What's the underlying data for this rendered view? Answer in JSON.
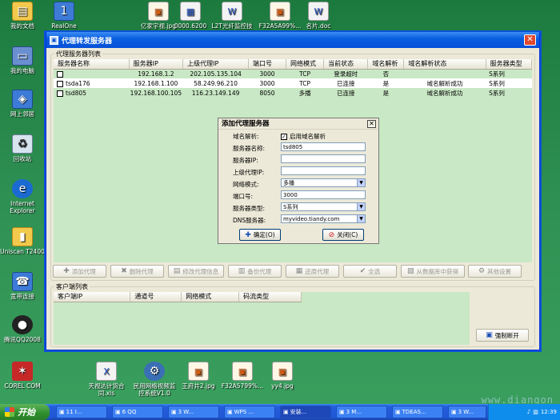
{
  "desktop": {
    "icons": [
      {
        "label": "我的文档",
        "glyph": "▤",
        "kind": "folder"
      },
      {
        "label": "我的电脑",
        "glyph": "▭",
        "kind": "pc"
      },
      {
        "label": "网上邻居",
        "glyph": "◈",
        "kind": "net"
      },
      {
        "label": "回收站",
        "glyph": "♻",
        "kind": "bin"
      },
      {
        "label": "Internet Explorer",
        "glyph": "e",
        "kind": "ie"
      },
      {
        "label": "Uniscan T2400",
        "glyph": "▮",
        "kind": "folder"
      },
      {
        "label": "宽带连接",
        "glyph": "☎",
        "kind": "net"
      },
      {
        "label": "腾讯QQ2008",
        "glyph": "●",
        "kind": "qq"
      },
      {
        "label": "COREL COM",
        "glyph": "✶",
        "kind": "red"
      },
      {
        "label": "RealOne Player",
        "glyph": "1",
        "kind": "net"
      },
      {
        "label": "亿家宇视.jpg",
        "glyph": "▣",
        "kind": "jpg"
      },
      {
        "label": "0000.6200",
        "glyph": "▦",
        "kind": "doc"
      },
      {
        "label": "L2T光纤监控技术方案...",
        "glyph": "W",
        "kind": "doc"
      },
      {
        "label": "F32A5A99%...",
        "glyph": "▣",
        "kind": "jpg"
      },
      {
        "label": "名片.doc",
        "glyph": "W",
        "kind": "doc"
      },
      {
        "label": "天视达计货合同.xls",
        "glyph": "X",
        "kind": "doc"
      },
      {
        "label": "民用网络视频监控系统V1.0",
        "glyph": "⚙",
        "kind": "gear"
      },
      {
        "label": "王府井2.jpg",
        "glyph": "▣",
        "kind": "jpg"
      },
      {
        "label": "F32A5799%...",
        "glyph": "▣",
        "kind": "jpg"
      },
      {
        "label": "yy4.jpg",
        "glyph": "▣",
        "kind": "jpg"
      }
    ]
  },
  "window": {
    "title": "代理转发服务器",
    "close_glyph": "✕",
    "server_list": {
      "legend": "代理服务器列表",
      "columns": [
        "服务器名称",
        "服务器IP",
        "上级代理IP",
        "端口号",
        "网络模式",
        "当前状态",
        "域名解析",
        "域名解析状态",
        "服务器类型"
      ],
      "rows": [
        {
          "name": "",
          "ip": "192.168.1.2",
          "proxy": "202.105.135.104",
          "port": "3000",
          "mode": "TCP",
          "status": "登录超时",
          "dns": "否",
          "dns_status": "",
          "type": "S系列"
        },
        {
          "name": "tsda176",
          "ip": "192.168.1.100",
          "proxy": "58.249.96.210",
          "port": "3000",
          "mode": "TCP",
          "status": "已连接",
          "dns": "是",
          "dns_status": "域名解析成功",
          "type": "S系列"
        },
        {
          "name": "tsd805",
          "ip": "192.168.100.105",
          "proxy": "116.23.149.149",
          "port": "8050",
          "mode": "多播",
          "status": "已连接",
          "dns": "是",
          "dns_status": "域名解析成功",
          "type": "S系列"
        }
      ]
    },
    "toolbar": {
      "add": "添加代理",
      "delete": "删除代理",
      "modify": "修改代理信息",
      "backup": "备份代理",
      "restore": "还原代理",
      "select_all": "全选",
      "from_db": "从数据库中获得",
      "other": "其他设置"
    },
    "client_list": {
      "legend": "客户端列表",
      "columns": [
        "客户端IP",
        "通道号",
        "网络模式",
        "码流类型"
      ],
      "force_disconnect": "强制断开"
    }
  },
  "dialog": {
    "title": "添加代理服务器",
    "close_glyph": "✕",
    "dns_label": "域名解析:",
    "dns_checkbox": "启用域名解析",
    "dns_checked": true,
    "name_label": "服务器名称:",
    "name_value": "tsd805",
    "ip_label": "服务器IP:",
    "ip_value": "",
    "proxy_label": "上级代理IP:",
    "proxy_value": "",
    "mode_label": "网络模式:",
    "mode_value": "多播",
    "port_label": "端口号:",
    "port_value": "3000",
    "type_label": "服务器类型:",
    "type_value": "S系列",
    "dns_server_label": "DNS服务器:",
    "dns_server_value": "myvideo.tiandy.com",
    "ok": "确定(O)",
    "close": "关闭(C)"
  },
  "taskbar": {
    "start": "开始",
    "tasks": [
      "11 I...",
      "6 QQ",
      "3 W...",
      "WPS ...",
      "安装...",
      "3 M...",
      "TDEAS...",
      "3 W..."
    ],
    "clock": "12:39"
  },
  "watermark": "www.diangon"
}
